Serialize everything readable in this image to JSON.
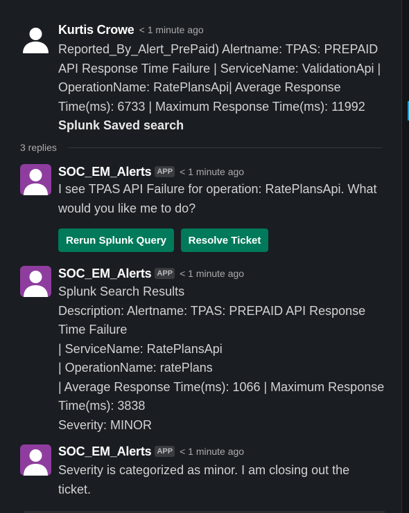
{
  "messages": [
    {
      "author": "Kurtis Crowe",
      "time": "< 1 minute ago",
      "lines": [
        "Reported_By_Alert_PrePaid) Alertname: TPAS: PREPAID",
        "API Response Time Failure | ServiceName: ValidationApi |",
        "OperationName: RatePlansApi| Average Response",
        "Time(ms): 6733 | Maximum Response Time(ms): 11992"
      ],
      "footer_bold": "Splunk Saved search"
    },
    {
      "author": "SOC_EM_Alerts",
      "badge": "APP",
      "time": "< 1 minute ago",
      "lines": [
        "I see TPAS API Failure for operation: RatePlansApi. What",
        "would you like me to do?"
      ],
      "buttons": [
        "Rerun Splunk Query",
        "Resolve Ticket"
      ]
    },
    {
      "author": "SOC_EM_Alerts",
      "badge": "APP",
      "time": "< 1 minute ago",
      "lines": [
        "Splunk Search Results",
        "Description: Alertname: TPAS: PREPAID API Response",
        "Time Failure",
        "| ServiceName: RatePlansApi",
        "| OperationName: ratePlans",
        "| Average Response Time(ms): 1066 | Maximum Response",
        "Time(ms): 3838",
        "Severity: MINOR"
      ]
    },
    {
      "author": "SOC_EM_Alerts",
      "badge": "APP",
      "time": "< 1 minute ago",
      "lines": [
        "Severity is categorized as minor. I am closing out the",
        "ticket."
      ]
    }
  ],
  "replies_label": "3 replies",
  "colors": {
    "background": "#1a1d21",
    "button_green": "#007a5a",
    "app_avatar": "#8e3d9e",
    "user_avatar_bg": "#1a1d21"
  },
  "icons": {
    "user_avatar": "default-user-avatar-icon",
    "app_avatar": "bot-avatar-icon"
  }
}
